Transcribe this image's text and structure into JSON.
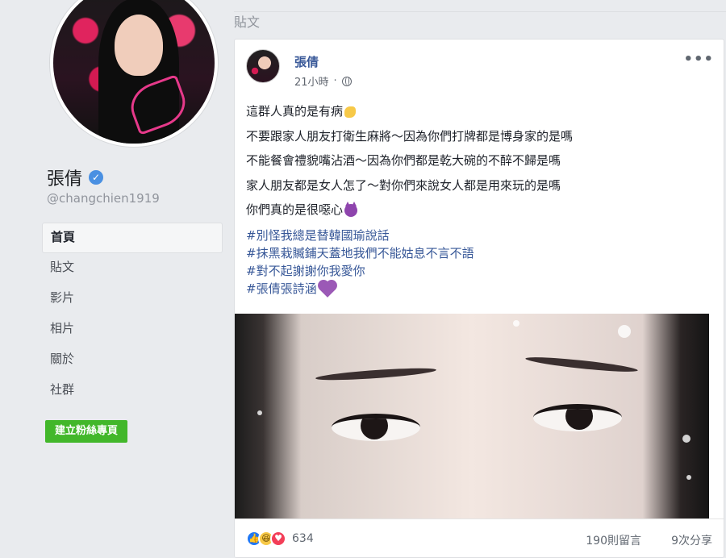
{
  "profile": {
    "name": "張倩",
    "handle": "@changchien1919",
    "verified": true
  },
  "nav": {
    "items": [
      {
        "label": "首頁",
        "active": true
      },
      {
        "label": "貼文",
        "active": false
      },
      {
        "label": "影片",
        "active": false
      },
      {
        "label": "相片",
        "active": false
      },
      {
        "label": "關於",
        "active": false
      },
      {
        "label": "社群",
        "active": false
      }
    ],
    "create_page_label": "建立粉絲專頁"
  },
  "section": {
    "title": "貼文"
  },
  "post": {
    "author": "張倩",
    "time": "21小時",
    "privacy_icon": "globe-icon",
    "more_icon": "more-icon",
    "more_label": "•••",
    "lines": [
      "這群人真的是有病",
      "不要跟家人朋友打衛生麻將～因為你們打牌都是博身家的是嗎",
      "不能餐會禮貌嘴沾酒～因為你們都是乾大碗的不醉不歸是嗎",
      "家人朋友都是女人怎了～對你們來說女人都是用來玩的是嗎",
      "你們真的是很噁心"
    ],
    "hashtags": [
      "#別怪我總是替韓國瑜說話",
      "#抹黑栽贓鋪天蓋地我們不能姑息不言不語",
      "#對不起謝謝你我愛你",
      "#張倩張詩涵"
    ],
    "reactions": {
      "count": "634",
      "types": [
        "like-icon",
        "haha-icon",
        "love-icon"
      ]
    },
    "comments": "190則留言",
    "shares": "9次分享"
  },
  "colors": {
    "page_bg": "#e9ebee",
    "link": "#385898",
    "button_green": "#42b72a",
    "verified_blue": "#4a90e2"
  }
}
